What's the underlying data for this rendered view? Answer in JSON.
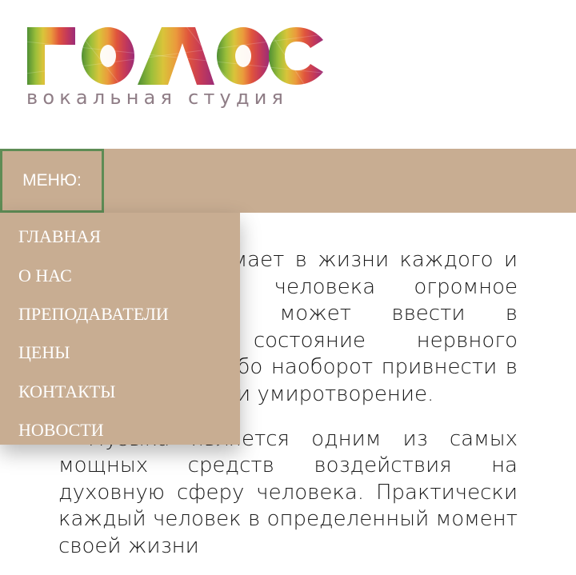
{
  "logo": {
    "title": "ГОЛОС",
    "subtitle": "вокальная студия",
    "colors": [
      "#5e9a3c",
      "#c8c83a",
      "#e6a23a",
      "#d8443c",
      "#a82f6e"
    ]
  },
  "menu": {
    "toggle_label": "МЕНЮ:",
    "items": [
      {
        "label": "ГЛАВНАЯ"
      },
      {
        "label": "О НАС"
      },
      {
        "label": "ПРЕПОДАВАТЕЛИ"
      },
      {
        "label": "ЦЕНЫ"
      },
      {
        "label": "КОНТАКТЫ"
      },
      {
        "label": "НОВОСТИ"
      }
    ]
  },
  "article": {
    "paragraph_1": "Музыка занимает в жизни каждого и на состояние человека огромное влияние. Она может ввести в подавленное состояние нервного напряжения, либо наоборот привнести в его душу покой и умиротворение.",
    "paragraph_2": "Музыка является одним из самых мощных средств воздействия на духовную сферу человека. Практически каждый человек в определенный момент своей жизни"
  },
  "colors": {
    "menu_bg": "#c8ad92",
    "toggle_border": "#5e8c55",
    "menu_text": "#ffffff"
  }
}
